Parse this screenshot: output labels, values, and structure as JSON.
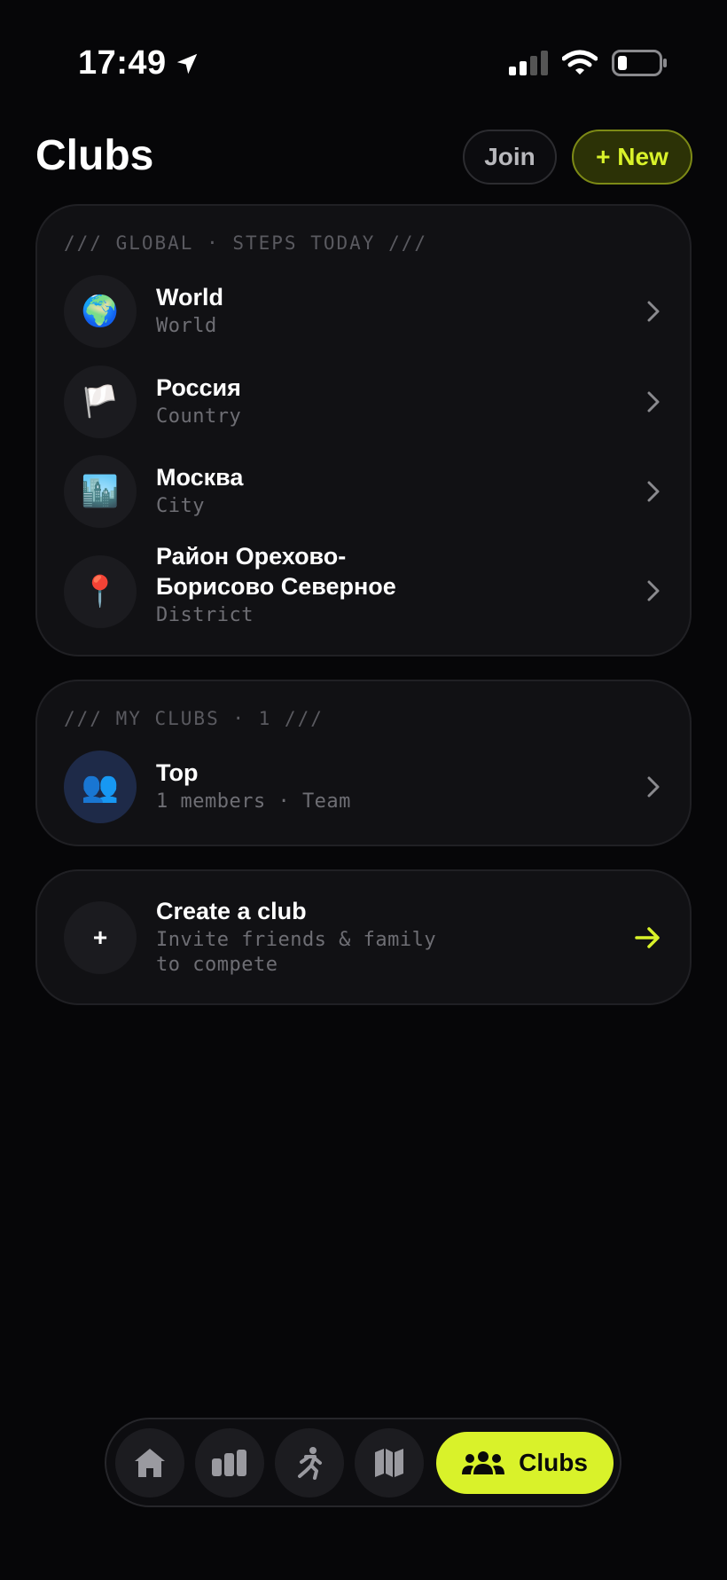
{
  "status": {
    "time": "17:49",
    "icons": [
      "location-arrow-icon",
      "signal-icon",
      "wifi-icon",
      "battery-icon"
    ]
  },
  "header": {
    "title": "Clubs",
    "join_label": "Join",
    "new_label": "+ New"
  },
  "colors": {
    "accent": "#d9f22a",
    "background": "#060608",
    "card": "#111114",
    "muted": "#6e6e74"
  },
  "global": {
    "label": "/// GLOBAL · STEPS TODAY ///",
    "items": [
      {
        "icon": "globe-icon",
        "glyph": "🌍",
        "title": "World",
        "sub": "World"
      },
      {
        "icon": "white-flag-icon",
        "glyph": "🏳️",
        "title": "Россия",
        "sub": "Country"
      },
      {
        "icon": "city-icon",
        "glyph": "🏙️",
        "title": "Москва",
        "sub": "City"
      },
      {
        "icon": "pin-icon",
        "glyph": "📍",
        "title_line1": "Район Орехово-",
        "title_line2": "Борисово Северное",
        "sub": "District"
      }
    ]
  },
  "my_clubs": {
    "label": "/// MY CLUBS · 1 ///",
    "items": [
      {
        "icon": "team-icon",
        "glyph": "👥",
        "title": "Top",
        "sub": "1 members · Team"
      }
    ]
  },
  "create": {
    "icon_glyph": "+",
    "title": "Create a club",
    "sub_line1": "Invite friends & family",
    "sub_line2": "to compete"
  },
  "nav": {
    "items": [
      "home-icon",
      "leaderboard-icon",
      "activity-icon",
      "map-icon"
    ],
    "active_label": "Clubs"
  }
}
